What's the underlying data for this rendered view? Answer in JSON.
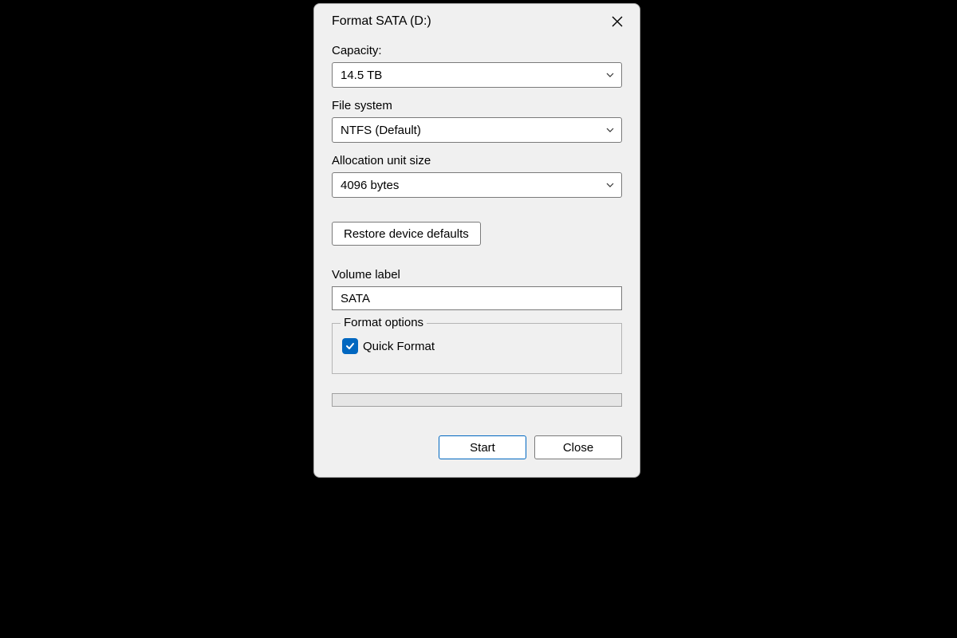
{
  "dialog": {
    "title": "Format SATA (D:)",
    "capacity": {
      "label": "Capacity:",
      "value": "14.5 TB"
    },
    "filesystem": {
      "label": "File system",
      "value": "NTFS (Default)"
    },
    "allocation": {
      "label": "Allocation unit size",
      "value": "4096 bytes"
    },
    "restore_defaults_label": "Restore device defaults",
    "volume_label": {
      "label": "Volume label",
      "value": "SATA"
    },
    "format_options": {
      "legend": "Format options",
      "quick_format_label": "Quick Format",
      "quick_format_checked": true
    },
    "buttons": {
      "start": "Start",
      "close": "Close"
    }
  }
}
